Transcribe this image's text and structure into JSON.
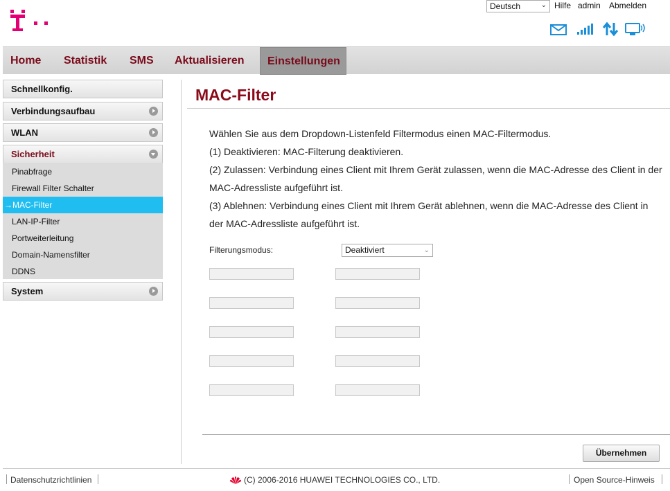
{
  "header": {
    "language": "Deutsch",
    "links": [
      "Hilfe",
      "admin",
      "Abmelden"
    ]
  },
  "nav": {
    "items": [
      "Home",
      "Statistik",
      "SMS",
      "Aktualisieren",
      "Einstellungen"
    ],
    "active": "Einstellungen"
  },
  "sidebar": {
    "quick": "Schnellkonfig.",
    "connection": "Verbindungsaufbau",
    "wlan": "WLAN",
    "security": "Sicherheit",
    "security_items": [
      "Pinabfrage",
      "Firewall Filter Schalter",
      "→MAC-Filter",
      "LAN-IP-Filter",
      "Portweiterleitung",
      "Domain-Namensfilter",
      "DDNS"
    ],
    "system": "System"
  },
  "main": {
    "title": "MAC-Filter",
    "paragraphs": [
      "Wählen Sie aus dem Dropdown-Listenfeld Filtermodus einen MAC-Filtermodus.",
      "(1) Deaktivieren: MAC-Filterung deaktivieren.",
      "(2) Zulassen: Verbindung eines Client mit Ihrem Gerät zulassen, wenn die MAC-Adresse des Client in der",
      "MAC-Adressliste aufgeführt ist.",
      "(3) Ablehnen: Verbindung eines Client mit Ihrem Gerät ablehnen, wenn die MAC-Adresse des Client in",
      "der MAC-Adressliste aufgeführt ist."
    ],
    "filter_label": "Filterungsmodus:",
    "filter_value": "Deaktiviert",
    "apply_button": "Übernehmen"
  },
  "footer": {
    "privacy": "Datenschutzrichtlinien",
    "copyright": "(C) 2006-2016 HUAWEI TECHNOLOGIES CO., LTD.",
    "open_source": "Open Source-Hinweis"
  },
  "colors": {
    "brand": "#e20074",
    "accent": "#8a0a1a",
    "active_item": "#1fbdf0",
    "icons": "#1a8ed8"
  },
  "icons": [
    "telekom-logo",
    "mail-icon",
    "signal-icon",
    "data-transfer-icon",
    "wifi-device-icon",
    "huawei-logo"
  ]
}
